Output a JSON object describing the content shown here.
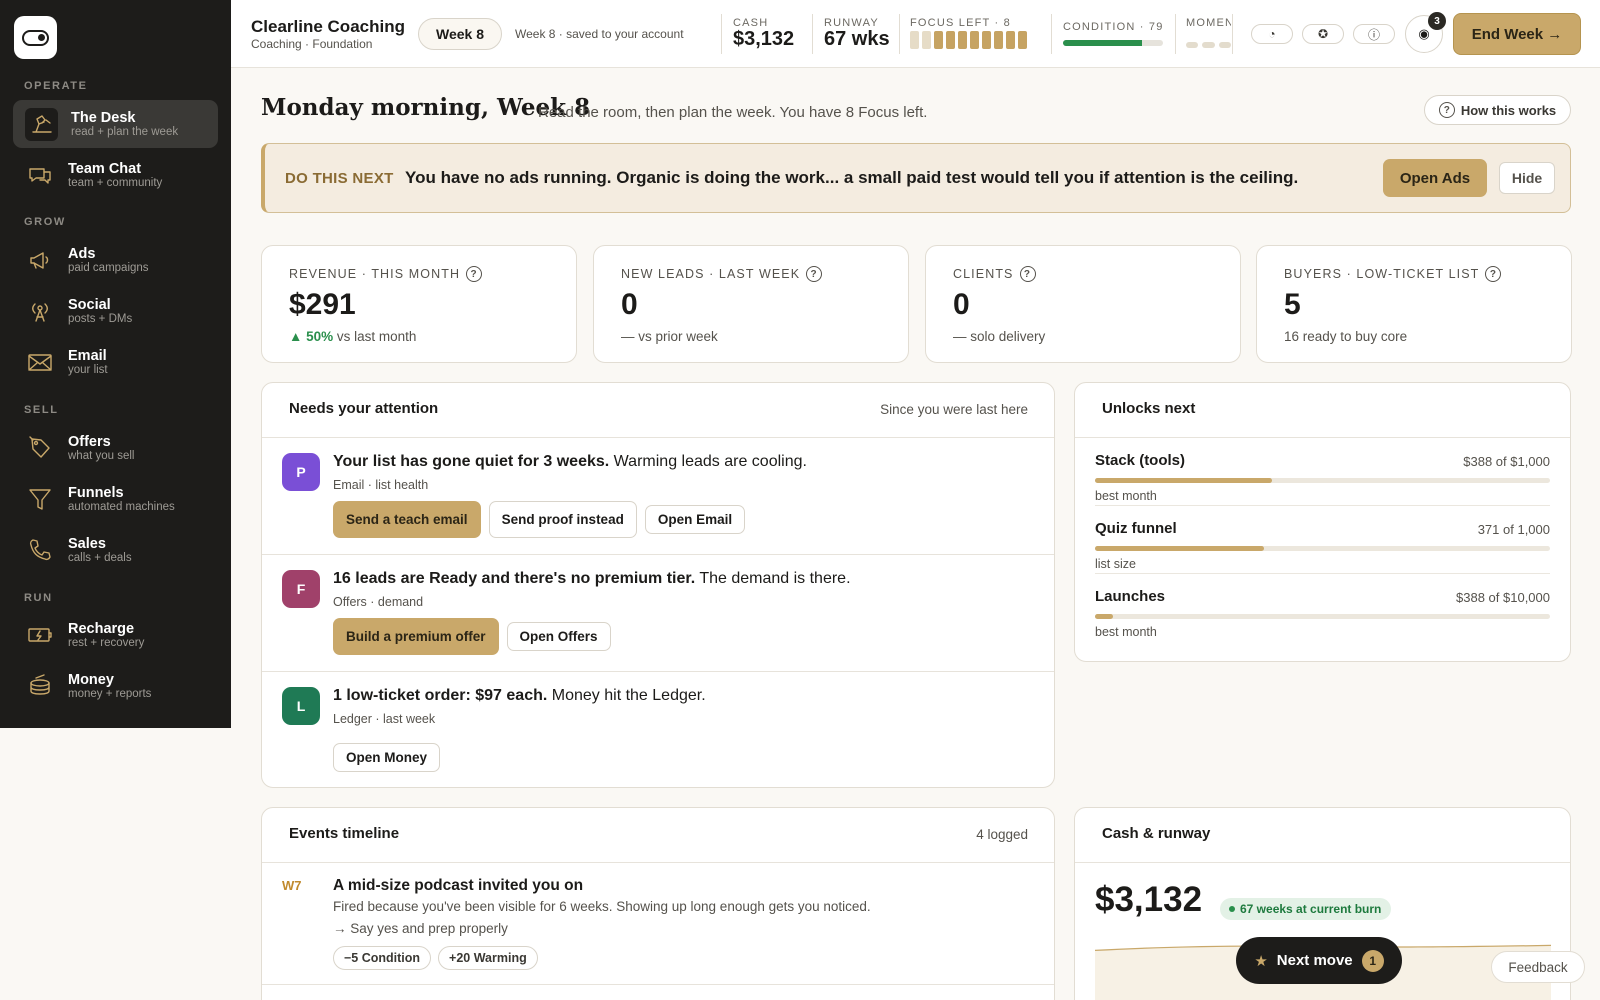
{
  "sidebar": {
    "sections": [
      "OPERATE",
      "GROW",
      "SELL",
      "RUN"
    ],
    "items": [
      {
        "label": "The Desk",
        "sub": "read + plan the week",
        "icon": "desk-lamp-icon"
      },
      {
        "label": "Team Chat",
        "sub": "team + community",
        "icon": "chat-bubbles-icon"
      },
      {
        "label": "Ads",
        "sub": "paid campaigns",
        "icon": "megaphone-icon"
      },
      {
        "label": "Social",
        "sub": "posts + DMs",
        "icon": "broadcast-tower-icon"
      },
      {
        "label": "Email",
        "sub": "your list",
        "icon": "envelope-icon"
      },
      {
        "label": "Offers",
        "sub": "what you sell",
        "icon": "price-tag-icon"
      },
      {
        "label": "Funnels",
        "sub": "automated machines",
        "icon": "funnel-icon"
      },
      {
        "label": "Sales",
        "sub": "calls + deals",
        "icon": "phone-icon"
      },
      {
        "label": "Recharge",
        "sub": "rest + recovery",
        "icon": "battery-charge-icon"
      },
      {
        "label": "Money",
        "sub": "money + reports",
        "icon": "coin-stack-icon"
      }
    ]
  },
  "topbar": {
    "title": "Clearline Coaching",
    "subtitle": "Coaching · Foundation",
    "week": "Week 8",
    "saved": "Week 8 · saved to your account",
    "cash_label": "CASH",
    "cash_value": "$3,132",
    "runway_label": "RUNWAY",
    "runway_value": "67 wks",
    "focus_label": "FOCUS LEFT · 8",
    "focus_filled": 8,
    "focus_total": 10,
    "condition_label": "CONDITION · 79",
    "condition_value": 79,
    "momentum_label": "MOMENTUM",
    "notification_count": "3",
    "end_week": "End Week →"
  },
  "header": {
    "title": "Monday morning, Week 8",
    "subtitle": "Read the room, then plan the week. You have 8 Focus left.",
    "how_button": "How this works"
  },
  "next_banner": {
    "tag": "DO THIS NEXT",
    "message": "You have no ads running. Organic is doing the work... a small paid test would tell you if attention is the ceiling.",
    "primary": "Open Ads",
    "secondary": "Hide"
  },
  "kpis": [
    {
      "label": "REVENUE · THIS MONTH",
      "value": "$291",
      "delta": "▲ 50%",
      "foot": "vs last month"
    },
    {
      "label": "NEW LEADS · LAST WEEK",
      "value": "0",
      "foot": "— vs prior week"
    },
    {
      "label": "CLIENTS",
      "value": "0",
      "foot": "— solo delivery"
    },
    {
      "label": "BUYERS · LOW-TICKET LIST",
      "value": "5",
      "foot": "16 ready to buy core"
    }
  ],
  "attention": {
    "title": "Needs your attention",
    "meta": "Since you were last here",
    "items": [
      {
        "initial": "P",
        "color": "#7a4fd6",
        "bold": "Your list has gone quiet for 3 weeks.",
        "rest": "Warming leads are cooling.",
        "meta": "Email · list health",
        "primary": "Send a teach email",
        "secondary": "Send proof instead",
        "link": "Open Email"
      },
      {
        "initial": "F",
        "color": "#a0416a",
        "bold": "16 leads are Ready and there's no premium tier.",
        "rest": "The demand is there.",
        "meta": "Offers · demand",
        "primary": "Build a premium offer",
        "link": "Open Offers"
      },
      {
        "initial": "L",
        "color": "#1f7a55",
        "bold": "1 low-ticket order: $97 each.",
        "rest": "Money hit the Ledger.",
        "meta": "Ledger · last week",
        "link": "Open Money"
      }
    ]
  },
  "unlocks": {
    "title": "Unlocks next",
    "items": [
      {
        "name": "Stack (tools)",
        "progress": "$388 of $1,000",
        "fraction": 0.388,
        "note": "best month"
      },
      {
        "name": "Quiz funnel",
        "progress": "371 of 1,000",
        "fraction": 0.371,
        "note": "list size"
      },
      {
        "name": "Launches",
        "progress": "$388 of $10,000",
        "fraction": 0.0388,
        "note": "best month"
      }
    ]
  },
  "events": {
    "title": "Events timeline",
    "meta": "4 logged",
    "items": [
      {
        "week": "W7",
        "title": "A mid-size podcast invited you on",
        "desc": "Fired because you've been visible for 6 weeks. Showing up long enough gets you noticed.",
        "action": "→ Say yes and prep properly",
        "tags": [
          "−5 Condition",
          "+20 Warming"
        ]
      }
    ]
  },
  "cash": {
    "title": "Cash & runway",
    "value": "$3,132",
    "pill": "67 weeks at current burn"
  },
  "floating": {
    "next_move": "Next move",
    "next_move_count": "1",
    "feedback": "Feedback"
  },
  "colors": {
    "accent": "#c9a86a",
    "sidebar": "#1d1c1a",
    "positive": "#2a8f4c"
  }
}
